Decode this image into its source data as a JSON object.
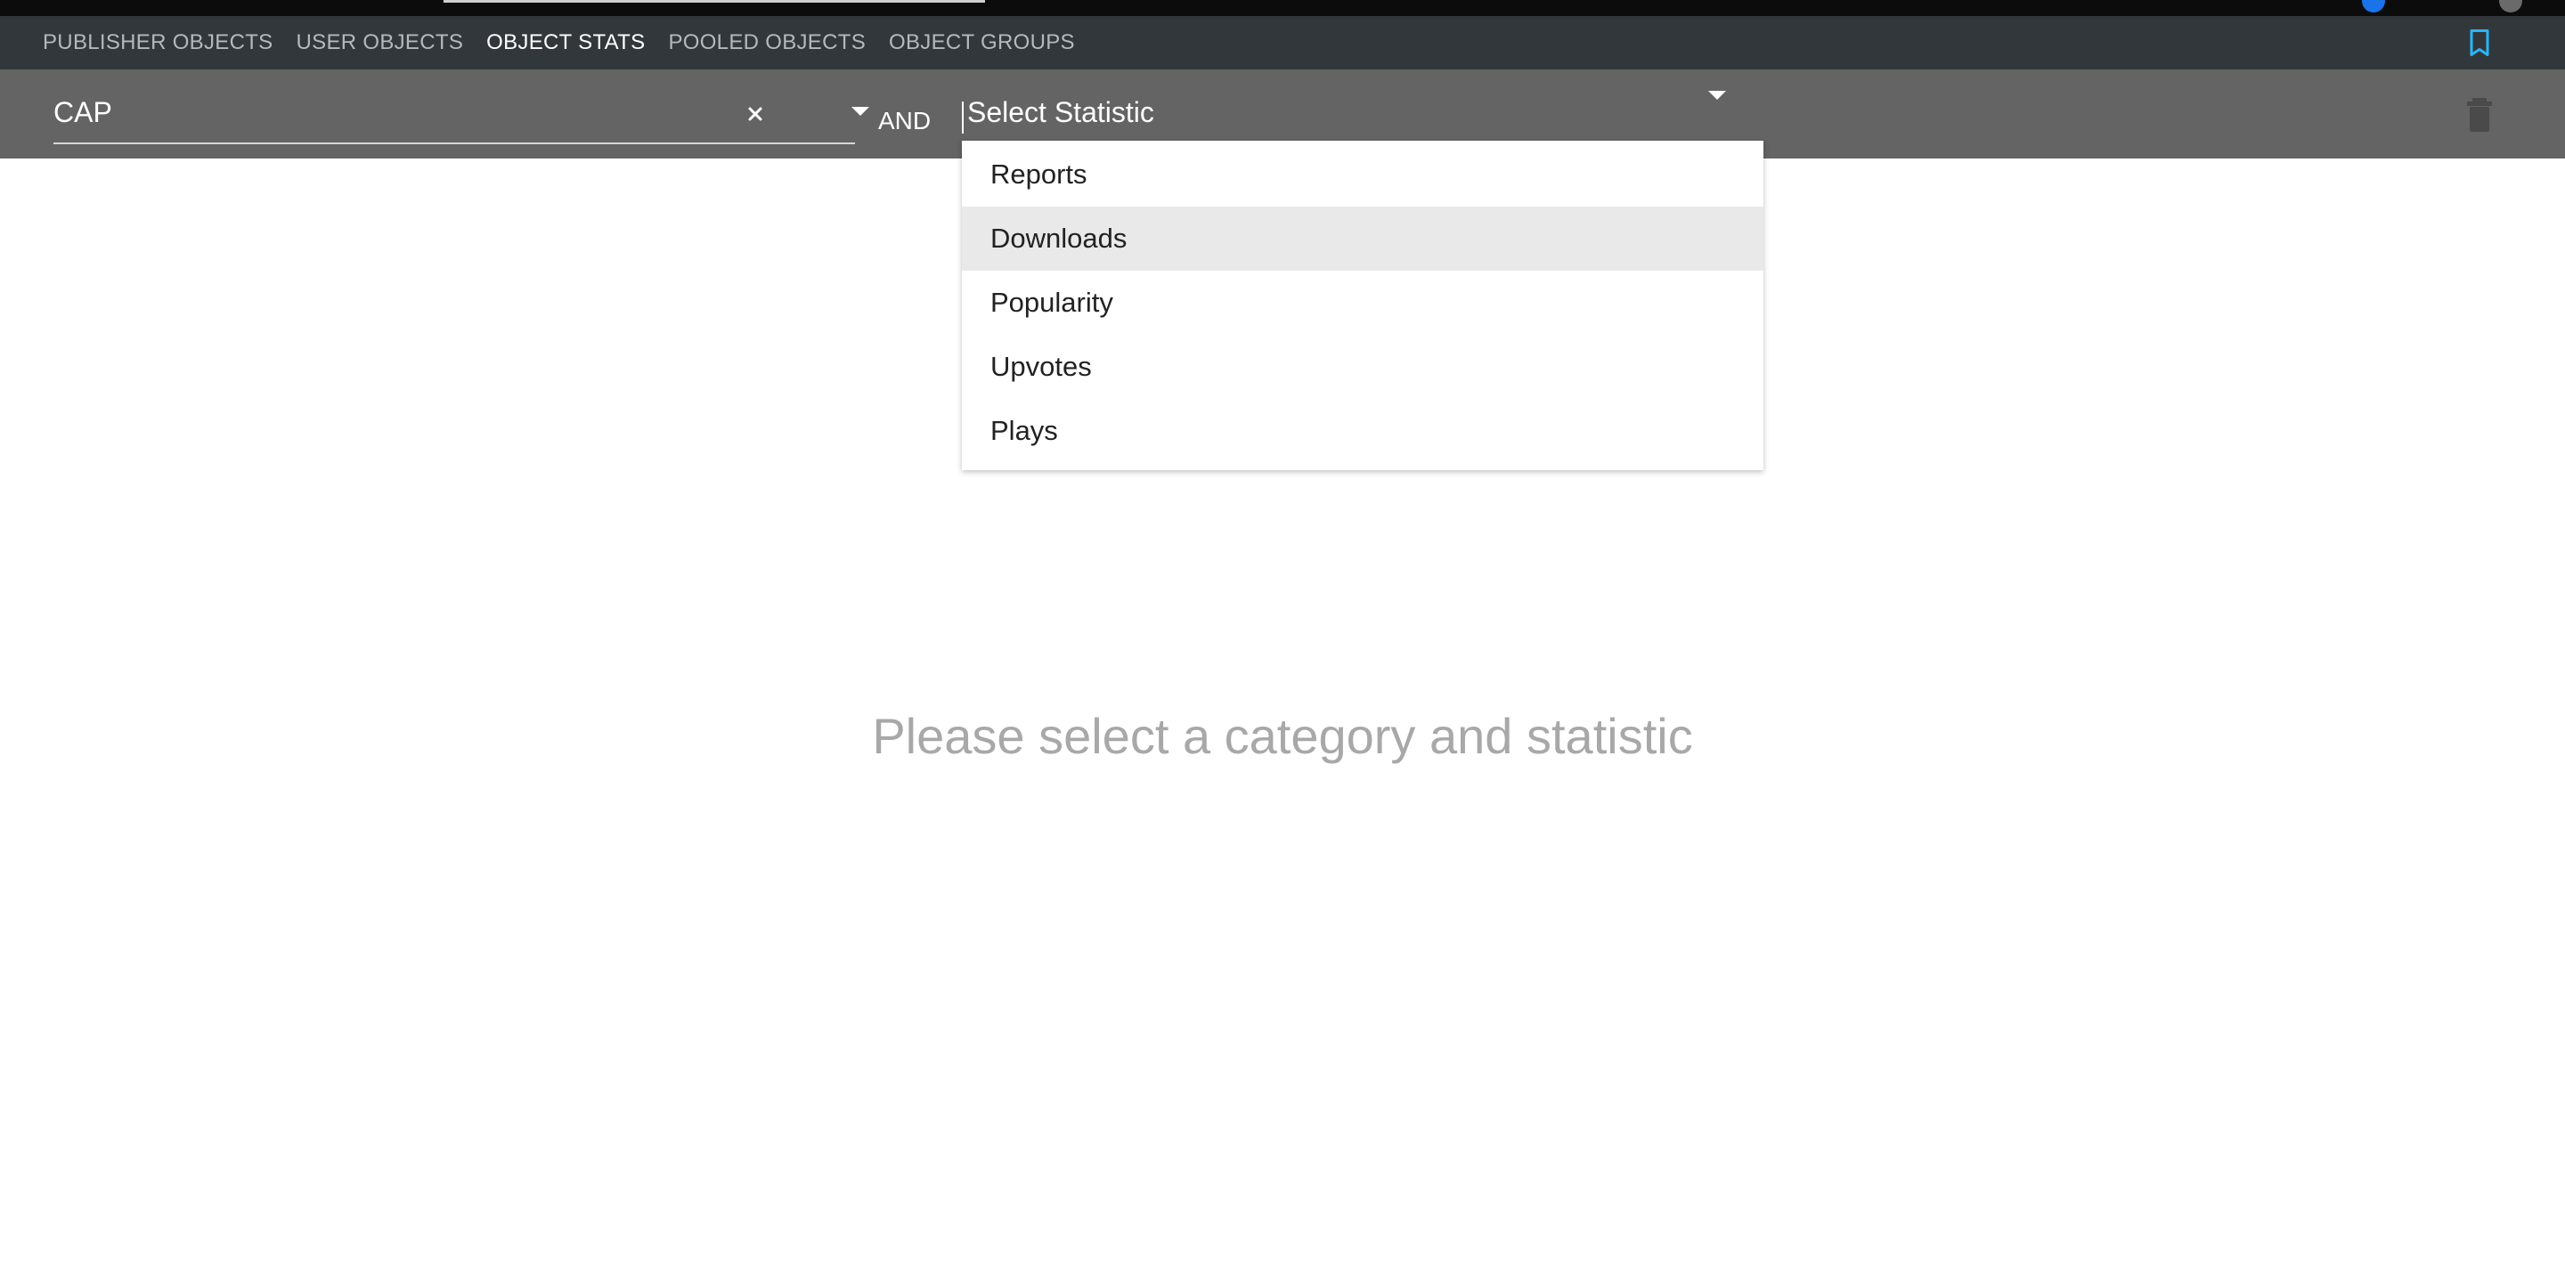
{
  "nav": {
    "tabs": [
      {
        "label": "PUBLISHER OBJECTS",
        "active": false
      },
      {
        "label": "USER OBJECTS",
        "active": false
      },
      {
        "label": "OBJECT STATS",
        "active": true
      },
      {
        "label": "POOLED OBJECTS",
        "active": false
      },
      {
        "label": "OBJECT GROUPS",
        "active": false
      }
    ],
    "bookmark_icon": "bookmark-icon",
    "bookmark_color": "#29b6f6"
  },
  "filter": {
    "category_value": "CAP",
    "connector_label": "AND",
    "statistic_placeholder": "Select Statistic",
    "clear_icon": "close-icon",
    "trash_icon": "trash-icon"
  },
  "dropdown": {
    "options": [
      "Reports",
      "Downloads",
      "Popularity",
      "Upvotes",
      "Plays"
    ],
    "highlighted": "Downloads"
  },
  "main": {
    "empty_message": "Please select a category and statistic"
  },
  "colors": {
    "navbar_bg": "#32373c",
    "filterbar_bg": "#646464",
    "highlight_bg": "#e9e9e9",
    "empty_text": "#a8a8a8"
  }
}
